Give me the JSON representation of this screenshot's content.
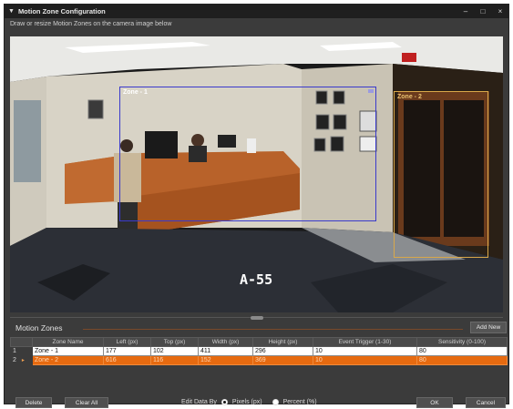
{
  "window": {
    "title": "Motion Zone Configuration",
    "controls": {
      "minimize": "–",
      "maximize": "□",
      "close": "×"
    }
  },
  "instruction": "Draw or resize Motion Zones on the camera image below",
  "camera": {
    "overlay_text": "A-55",
    "zones": [
      {
        "label": "Zone - 1",
        "color": "#3a3acc"
      },
      {
        "label": "Zone - 2",
        "color": "#d9a84a"
      }
    ]
  },
  "zones_panel": {
    "title": "Motion Zones",
    "add_button": "Add New",
    "columns": [
      "Zone Name",
      "Left (px)",
      "Top (px)",
      "Width (px)",
      "Height (px)",
      "Event Trigger (1-30)",
      "Sensitivity (0-100)"
    ],
    "rows": [
      {
        "index": "1",
        "pointer": "",
        "selected": false,
        "cells": [
          "Zone - 1",
          "177",
          "102",
          "411",
          "296",
          "10",
          "80"
        ]
      },
      {
        "index": "2",
        "pointer": "▸",
        "selected": true,
        "cells": [
          "Zone - 2",
          "616",
          "116",
          "152",
          "369",
          "10",
          "80"
        ]
      }
    ]
  },
  "bottom": {
    "delete_button": "Delete",
    "clear_button": "Clear All",
    "edit_by_label": "Edit Data By",
    "pixels_option": "Pixels (px)",
    "percent_option": "Percent (%)",
    "selected_unit": "pixels",
    "ok_button": "OK",
    "cancel_button": "Cancel"
  },
  "colors": {
    "accent_orange": "#e66a10",
    "zone1_blue": "#3a3acc",
    "zone2_gold": "#d9a84a"
  }
}
